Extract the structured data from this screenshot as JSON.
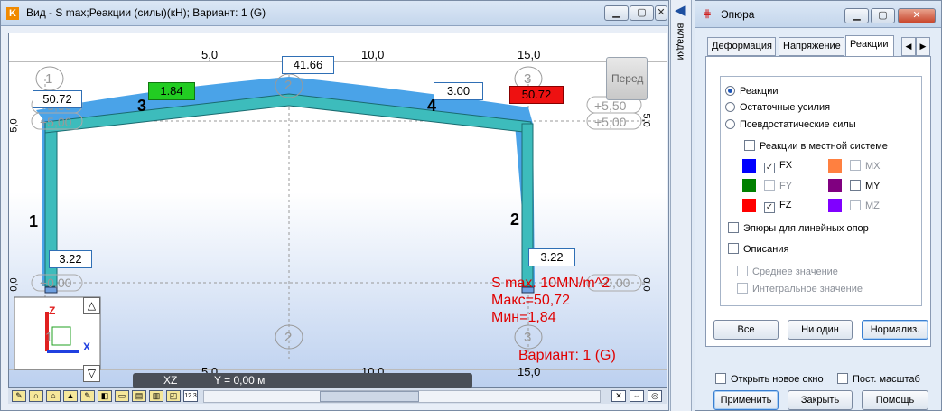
{
  "main_window": {
    "title": "Вид - S max;Реакции (силы)(кН); Вариант: 1 (G)",
    "controls": {
      "minimize": "▁",
      "maximize": "▢",
      "close": "✕"
    }
  },
  "canvas": {
    "axis_top": [
      "5,0",
      "10,0",
      "15,0"
    ],
    "axis_bottom": [
      "5,0",
      "10,0",
      "15,0"
    ],
    "left_axis_label": "5,0",
    "left_axis_label_low": "0,0",
    "right_axis_label": "5,0",
    "right_axis_label_low": "0,0",
    "node_circles": {
      "top_left": "1",
      "top_mid": "2",
      "top_right": "3",
      "bottom_left": "1",
      "bottom_mid": "2",
      "bottom_right": "3"
    },
    "grid_tags": {
      "left_top_1": "+5,50",
      "left_top_2": "+5,00",
      "left_bottom": "+0,00",
      "right_top_1": "+5,50",
      "right_top_2": "+5,00",
      "right_bottom": "+0,00"
    },
    "member_labels": {
      "m1": "1",
      "m2": "2",
      "m3": "3",
      "m4": "4"
    },
    "values": {
      "left_top": "50.72",
      "left_green": "1.84",
      "apex": "41.66",
      "right_slope": "3.00",
      "right_top": "50.72",
      "left_bottom": "3.22",
      "right_bottom": "3.22"
    },
    "view_button": "Перед",
    "axes_gizmo": {
      "z": "Z",
      "x": "X"
    },
    "legend_lines": [
      "S max. 10MN/m^2",
      "Макс=50,72",
      "Мин=1,84"
    ],
    "variant": "Вариант: 1 (G)"
  },
  "statusbar": {
    "plane": "XZ",
    "coord": "Y = 0,00 м",
    "icon_label": "12.3"
  },
  "side_tab": {
    "label": "вкладки"
  },
  "panel": {
    "title": "Эпюра",
    "tabs": [
      "Деформация",
      "Напряжение",
      "Реакции"
    ],
    "radios": [
      "Реакции",
      "Остаточные усилия",
      "Псевдостатические силы"
    ],
    "local_system": "Реакции в местной системе",
    "components": [
      {
        "name": "FX",
        "checked": true,
        "enabled": true,
        "color": "#0000ff"
      },
      {
        "name": "FY",
        "checked": false,
        "enabled": false,
        "color": "#008000"
      },
      {
        "name": "FZ",
        "checked": true,
        "enabled": true,
        "color": "#ff0000"
      },
      {
        "name": "MX",
        "checked": false,
        "enabled": false,
        "color": "#ff8040"
      },
      {
        "name": "MY",
        "checked": false,
        "enabled": true,
        "color": "#800080"
      },
      {
        "name": "MZ",
        "checked": false,
        "enabled": false,
        "color": "#8000ff"
      }
    ],
    "linear_supports": "Эпюры для линейных опор",
    "descriptions": "Описания",
    "avg_value": "Среднее значение",
    "integral_value": "Интегральное значение",
    "btn_all": "Все",
    "btn_none": "Ни один",
    "btn_normalize": "Нормализ.",
    "open_new_window": "Открыть новое окно",
    "const_scale": "Пост. масштаб",
    "btn_apply": "Применить",
    "btn_close": "Закрыть",
    "btn_help": "Помощь"
  }
}
